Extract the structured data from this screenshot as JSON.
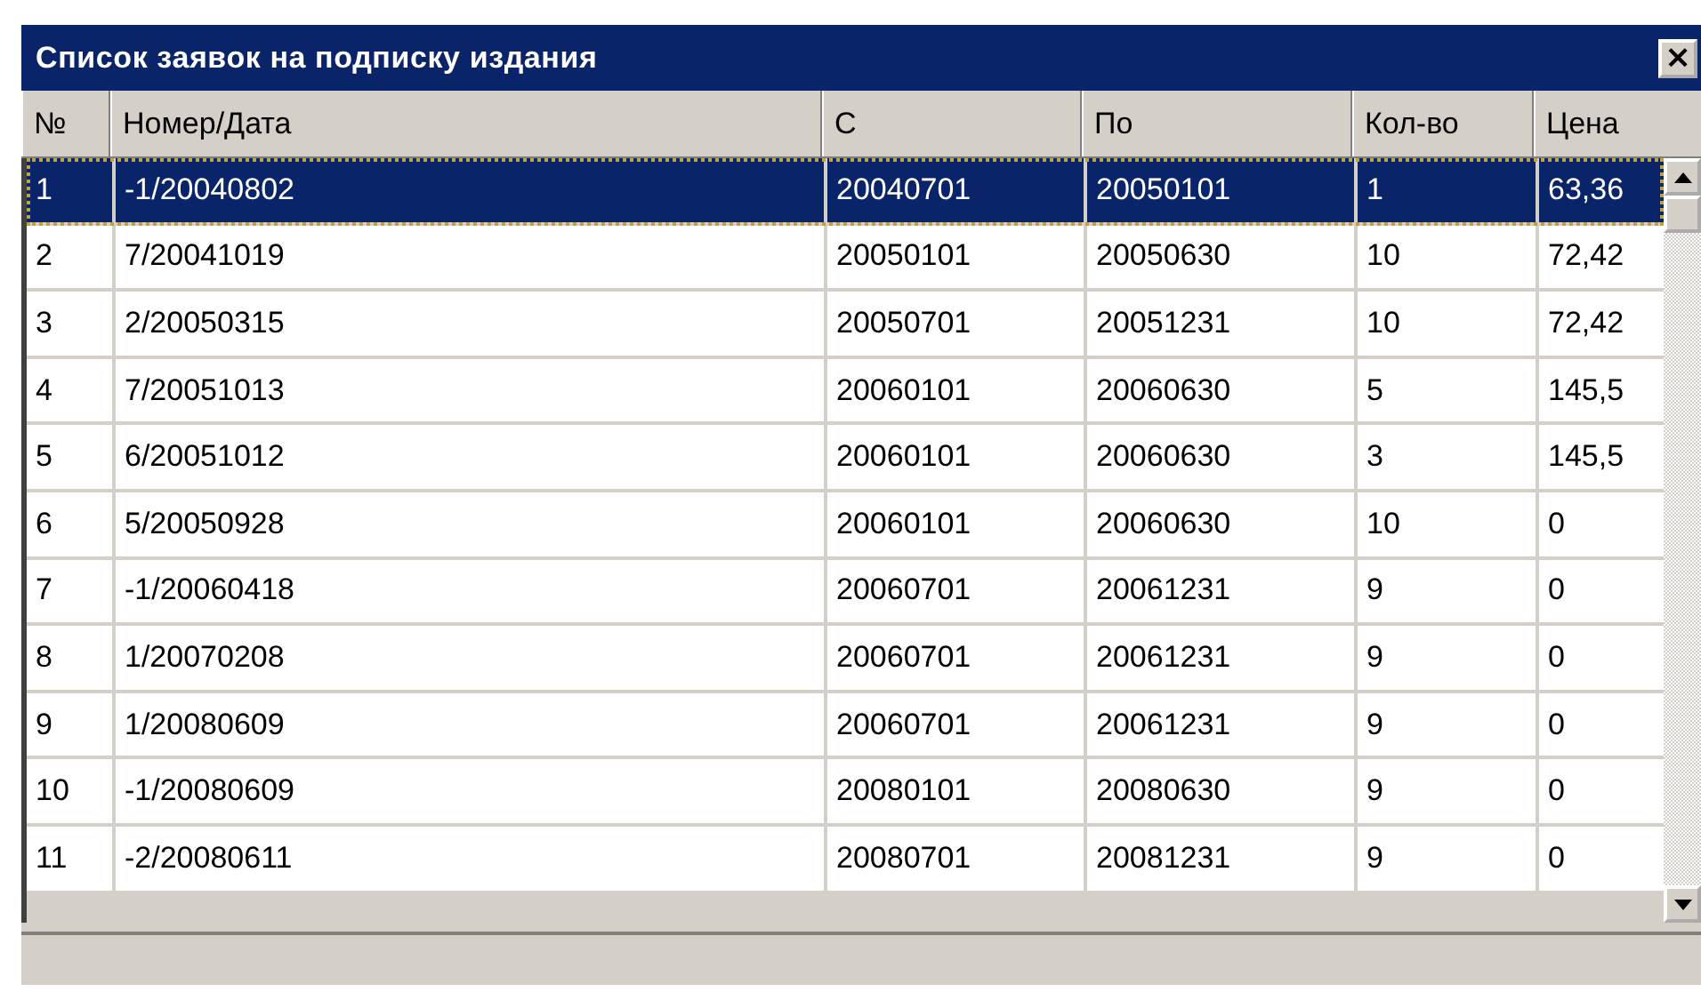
{
  "window": {
    "title": "Список заявок на подписку издания",
    "close": "×"
  },
  "table": {
    "columns": [
      "№",
      "Номер/Дата",
      "С",
      "По",
      "Кол-во",
      "Цена"
    ],
    "rows": [
      {
        "cells": [
          "1",
          "-1/20040802",
          "20040701",
          "20050101",
          "1",
          "63,36"
        ],
        "selected": true
      },
      {
        "cells": [
          "2",
          "7/20041019",
          "20050101",
          "20050630",
          "10",
          "72,42"
        ],
        "selected": false
      },
      {
        "cells": [
          "3",
          "2/20050315",
          "20050701",
          "20051231",
          "10",
          "72,42"
        ],
        "selected": false
      },
      {
        "cells": [
          "4",
          "7/20051013",
          "20060101",
          "20060630",
          "5",
          "145,5"
        ],
        "selected": false
      },
      {
        "cells": [
          "5",
          "6/20051012",
          "20060101",
          "20060630",
          "3",
          "145,5"
        ],
        "selected": false
      },
      {
        "cells": [
          "6",
          "5/20050928",
          "20060101",
          "20060630",
          "10",
          "0"
        ],
        "selected": false
      },
      {
        "cells": [
          "7",
          "-1/20060418",
          "20060701",
          "20061231",
          "9",
          "0"
        ],
        "selected": false
      },
      {
        "cells": [
          "8",
          "1/20070208",
          "20060701",
          "20061231",
          "9",
          "0"
        ],
        "selected": false
      },
      {
        "cells": [
          "9",
          "1/20080609",
          "20060701",
          "20061231",
          "9",
          "0"
        ],
        "selected": false
      },
      {
        "cells": [
          "10",
          "-1/20080609",
          "20080101",
          "20080630",
          "9",
          "0"
        ],
        "selected": false
      },
      {
        "cells": [
          "11",
          "-2/20080611",
          "20080701",
          "20081231",
          "9",
          "0"
        ],
        "selected": false
      }
    ]
  }
}
